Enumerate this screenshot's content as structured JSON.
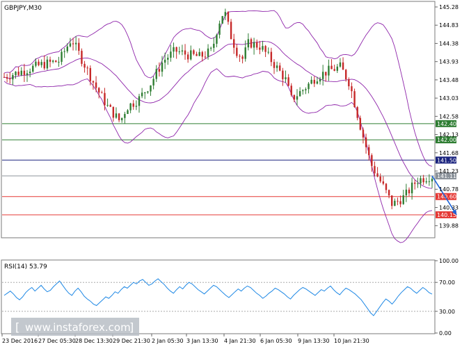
{
  "chart_data": [
    {
      "type": "candlestick",
      "title": "GBPJPY,M30",
      "ylim": [
        139.6,
        145.4
      ],
      "y_ticks": [
        "145.28",
        "144.83",
        "144.38",
        "143.93",
        "143.48",
        "143.03",
        "142.58",
        "142.13",
        "141.68",
        "141.23",
        "140.78",
        "140.33",
        "139.88"
      ],
      "x_ticks": [
        "23 Dec 2016",
        "27 Dec 05:30",
        "28 Dec 13:30",
        "29 Dec 21:30",
        "2 Jan 05:30",
        "3 Jan 13:30",
        "4 Jan 21:30",
        "6 Jan 05:30",
        "9 Jan 13:30",
        "10 Jan 21:30"
      ],
      "levels": [
        {
          "value": 142.4,
          "label": "142.40",
          "color": "#2e7d32"
        },
        {
          "value": 142.0,
          "label": "142.00",
          "color": "#2e7d32"
        },
        {
          "value": 141.5,
          "label": "141.50",
          "color": "#1a237e"
        },
        {
          "value": 141.11,
          "label": "141.11",
          "color": "#8c939b"
        },
        {
          "value": 140.6,
          "label": "140.60",
          "color": "#e53935"
        },
        {
          "value": 140.15,
          "label": "140.15",
          "color": "#e53935"
        }
      ],
      "close_path": [
        [
          0,
          143.55
        ],
        [
          6,
          143.7
        ],
        [
          12,
          143.85
        ],
        [
          18,
          143.95
        ],
        [
          22,
          144.5
        ],
        [
          26,
          143.9
        ],
        [
          30,
          143.3
        ],
        [
          34,
          142.8
        ],
        [
          38,
          142.45
        ],
        [
          40,
          142.8
        ],
        [
          44,
          143.0
        ],
        [
          48,
          143.4
        ],
        [
          52,
          143.95
        ],
        [
          56,
          144.2
        ],
        [
          60,
          144.1
        ],
        [
          64,
          144.05
        ],
        [
          68,
          144.2
        ],
        [
          70,
          144.85
        ],
        [
          72,
          145.2
        ],
        [
          74,
          144.6
        ],
        [
          76,
          144.2
        ],
        [
          78,
          144.0
        ],
        [
          80,
          144.4
        ],
        [
          84,
          144.3
        ],
        [
          88,
          143.9
        ],
        [
          92,
          143.5
        ],
        [
          94,
          143.0
        ],
        [
          98,
          143.25
        ],
        [
          102,
          143.55
        ],
        [
          106,
          143.7
        ],
        [
          110,
          143.8
        ],
        [
          113,
          143.4
        ],
        [
          117,
          142.2
        ],
        [
          120,
          141.4
        ],
        [
          124,
          140.85
        ],
        [
          127,
          140.4
        ],
        [
          131,
          140.6
        ],
        [
          135,
          141.0
        ],
        [
          139,
          141.1
        ]
      ],
      "colors": {
        "bull": "#2e7d32",
        "bear": "#c62828",
        "bands": "#8e24aa",
        "arrow": "#1e63d6"
      },
      "forecast": {
        "from": [
          140,
          141.11
        ],
        "to": [
          148,
          140.15
        ]
      }
    },
    {
      "type": "line",
      "title": "RSI(14) 53.79",
      "ylim": [
        0,
        100
      ],
      "y_ticks": [
        "100.00",
        "70.00",
        "30.00",
        "0.00"
      ],
      "levels": [
        70,
        30
      ],
      "values": [
        52,
        55,
        58,
        54,
        49,
        46,
        50,
        56,
        60,
        63,
        58,
        62,
        66,
        61,
        57,
        59,
        64,
        68,
        72,
        66,
        60,
        55,
        52,
        58,
        62,
        57,
        51,
        47,
        44,
        40,
        38,
        42,
        46,
        50,
        48,
        52,
        57,
        55,
        60,
        64,
        62,
        66,
        70,
        68,
        72,
        74,
        70,
        66,
        68,
        72,
        75,
        71,
        67,
        62,
        58,
        55,
        60,
        64,
        61,
        66,
        70,
        68,
        64,
        60,
        57,
        54,
        58,
        62,
        66,
        64,
        60,
        56,
        52,
        49,
        53,
        57,
        61,
        58,
        62,
        65,
        63,
        59,
        55,
        52,
        48,
        51,
        55,
        58,
        62,
        60,
        57,
        54,
        50,
        47,
        52,
        56,
        60,
        63,
        61,
        58,
        55,
        52,
        56,
        60,
        58,
        62,
        65,
        60,
        56,
        53,
        58,
        62,
        60,
        57,
        54,
        50,
        46,
        40,
        34,
        28,
        24,
        30,
        36,
        42,
        47,
        44,
        40,
        45,
        51,
        56,
        60,
        64,
        62,
        58,
        55,
        59,
        63,
        60,
        56,
        53.79
      ],
      "color": "#1e88e5"
    }
  ],
  "watermark": "www.instaforex.com"
}
